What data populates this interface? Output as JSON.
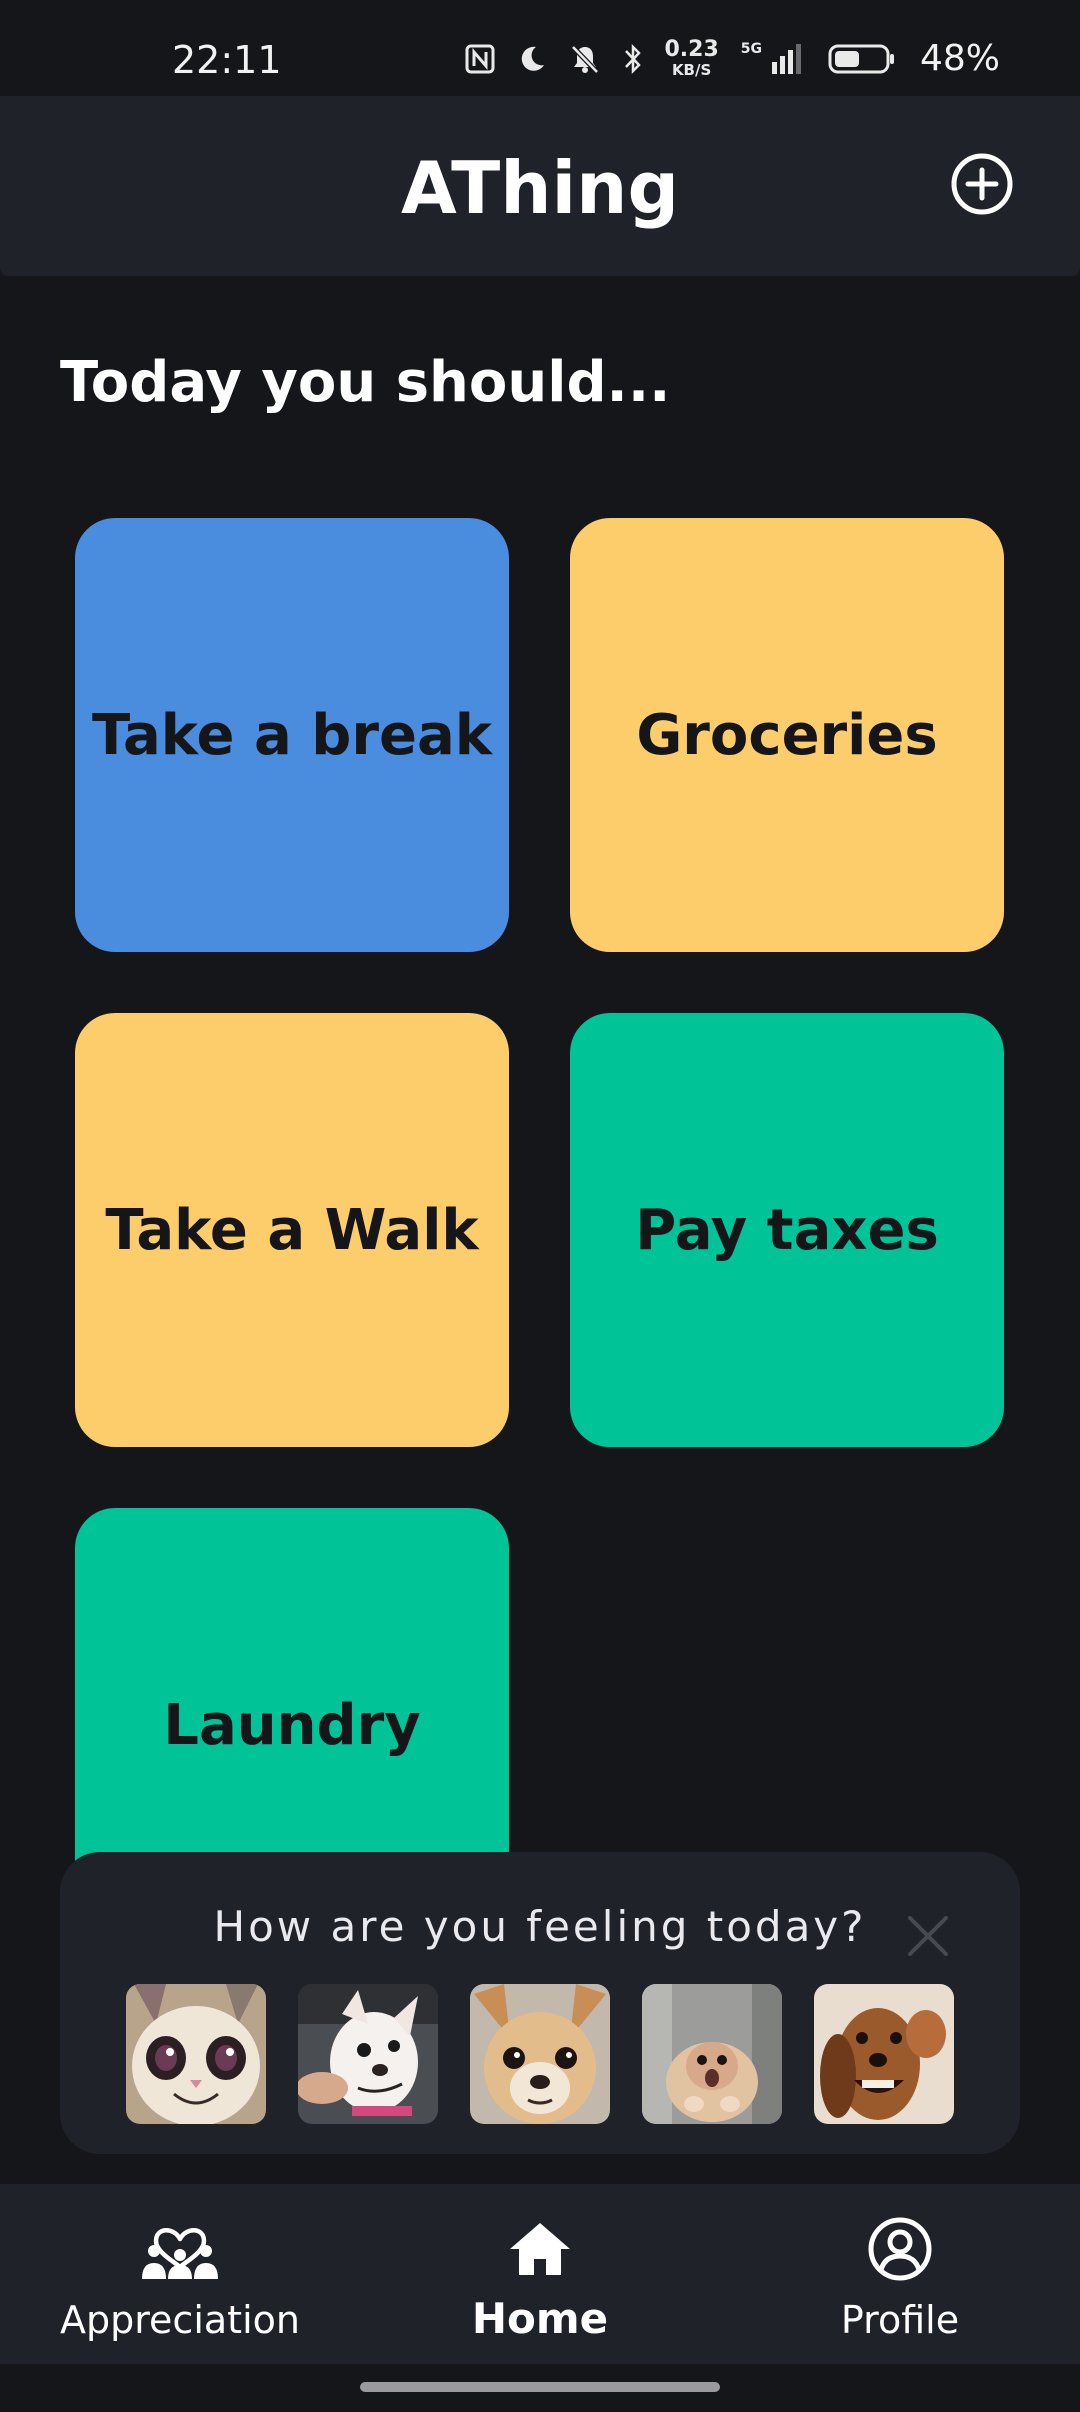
{
  "status_bar": {
    "time": "22:11",
    "net_speed_value": "0.23",
    "net_speed_unit": "KB/S",
    "network_type": "5G",
    "battery_percent": "48%",
    "icons": [
      "nfc-icon",
      "moon-icon",
      "bell-muted-icon",
      "bluetooth-icon",
      "signal-icon",
      "battery-icon"
    ]
  },
  "header": {
    "title": "AThing",
    "add_icon": "plus-circle-icon"
  },
  "main": {
    "heading": "Today you should...",
    "tasks": [
      {
        "label": "Take a break",
        "color": "#4a8ddf"
      },
      {
        "label": "Groceries",
        "color": "#fdcd6c"
      },
      {
        "label": "Take a Walk",
        "color": "#fdcd6c"
      },
      {
        "label": "Pay taxes",
        "color": "#00c497"
      },
      {
        "label": "Laundry",
        "color": "#00c497"
      }
    ]
  },
  "mood_prompt": {
    "question": "How are you feeling today?",
    "close_icon": "close-icon",
    "options": [
      "smiling-cat-face",
      "smirking-chihuahua-face",
      "worried-chihuahua-face",
      "shocked-hamster-face",
      "grinning-dachshund-face"
    ]
  },
  "bottom_nav": {
    "items": [
      {
        "label": "Appreciation",
        "icon": "people-heart-icon",
        "active": false
      },
      {
        "label": "Home",
        "icon": "home-icon",
        "active": true
      },
      {
        "label": "Profile",
        "icon": "user-circle-icon",
        "active": false
      }
    ]
  },
  "colors": {
    "background": "#15161a",
    "surface": "#1f2229",
    "blue": "#4a8ddf",
    "yellow": "#fdcd6c",
    "green": "#00c497"
  }
}
